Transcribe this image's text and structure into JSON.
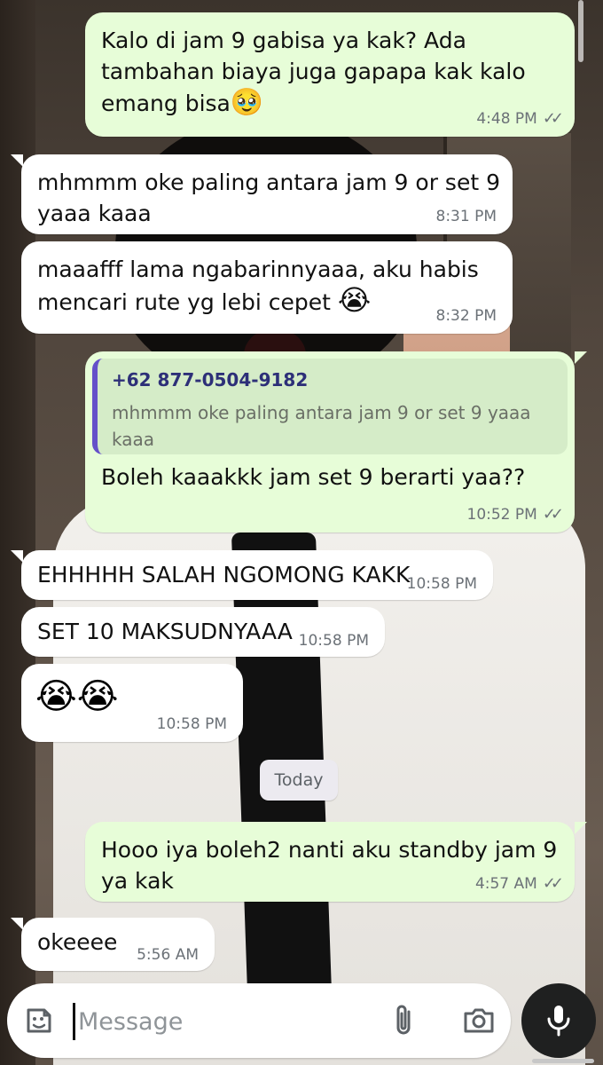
{
  "messages": [
    {
      "dir": "out",
      "text": "Kalo di jam 9 gabisa ya kak? Ada\ntambahan biaya juga gapapa kak kalo\nemang bisa",
      "emoji": "🥹",
      "time": "4:48 PM",
      "ticks": "✓✓"
    },
    {
      "dir": "in",
      "text": "mhmmm oke paling antara jam 9 or set 9\nyaaa kaaa",
      "time": "8:31 PM"
    },
    {
      "dir": "in",
      "text": "maaafff lama ngabarinnyaaa, aku habis\nmencari rute yg lebi cepet",
      "emoji": "😭",
      "time": "8:32 PM"
    },
    {
      "dir": "out",
      "reply_name": "+62 877-0504-9182",
      "reply_text": "mhmmm oke paling antara jam 9 or set 9 yaaa kaaa",
      "text": "Boleh kaaakkk jam set 9 berarti yaa??",
      "time": "10:52 PM",
      "ticks": "✓✓"
    },
    {
      "dir": "in",
      "text": "EHHHHH SALAH NGOMONG KAKK",
      "time": "10:58 PM"
    },
    {
      "dir": "in",
      "text": "SET 10 MAKSUDNYAAA",
      "time": "10:58 PM"
    },
    {
      "dir": "in",
      "text": "",
      "emoji": "😭😭",
      "time": "10:58 PM"
    },
    {
      "dir": "out",
      "text": "Hooo iya boleh2 nanti aku standby jam 9\nya kak",
      "time": "4:57 AM",
      "ticks": "✓✓"
    },
    {
      "dir": "in",
      "text": "okeeee",
      "time": "5:56 AM"
    }
  ],
  "day_separator": "Today",
  "composer": {
    "placeholder": "Message"
  },
  "icons": {
    "sticker": "sticker-icon",
    "attach": "paperclip-icon",
    "camera": "camera-icon",
    "mic": "microphone-icon"
  },
  "colors": {
    "outgoing_bubble": "#e7fdd8",
    "incoming_bubble": "#ffffff",
    "quote_bar": "#6550c9"
  }
}
